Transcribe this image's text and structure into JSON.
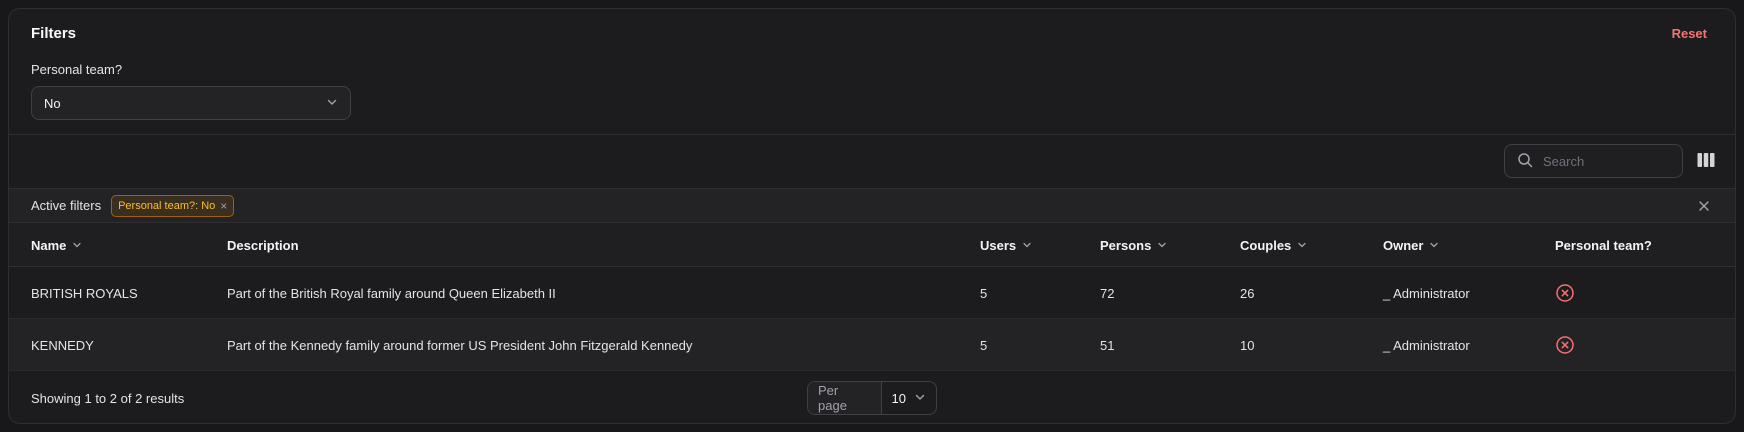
{
  "filters": {
    "title": "Filters",
    "reset_label": "Reset",
    "personal_team_label": "Personal team?",
    "personal_team_value": "No"
  },
  "toolbar": {
    "search_placeholder": "Search"
  },
  "active_filters": {
    "label": "Active filters",
    "badge": "Personal team?: No",
    "badge_remove": "×"
  },
  "table": {
    "columns": {
      "name": "Name",
      "description": "Description",
      "users": "Users",
      "persons": "Persons",
      "couples": "Couples",
      "owner": "Owner",
      "personal_team": "Personal team?"
    },
    "rows": [
      {
        "name": "BRITISH ROYALS",
        "description": "Part of the British Royal family around Queen Elizabeth II",
        "users": "5",
        "persons": "72",
        "couples": "26",
        "owner": "_ Administrator",
        "personal_team_icon": "x-circle-icon"
      },
      {
        "name": "KENNEDY",
        "description": "Part of the Kennedy family around former US President John Fitzgerald Kennedy",
        "users": "5",
        "persons": "51",
        "couples": "10",
        "owner": "_ Administrator",
        "personal_team_icon": "x-circle-icon"
      }
    ]
  },
  "footer": {
    "showing": "Showing 1 to 2 of 2 results",
    "per_page_label": "Per page",
    "per_page_value": "10"
  },
  "colors": {
    "accent_red": "#f87171",
    "badge_amber": "#fbbf24",
    "background": "#18181b"
  }
}
